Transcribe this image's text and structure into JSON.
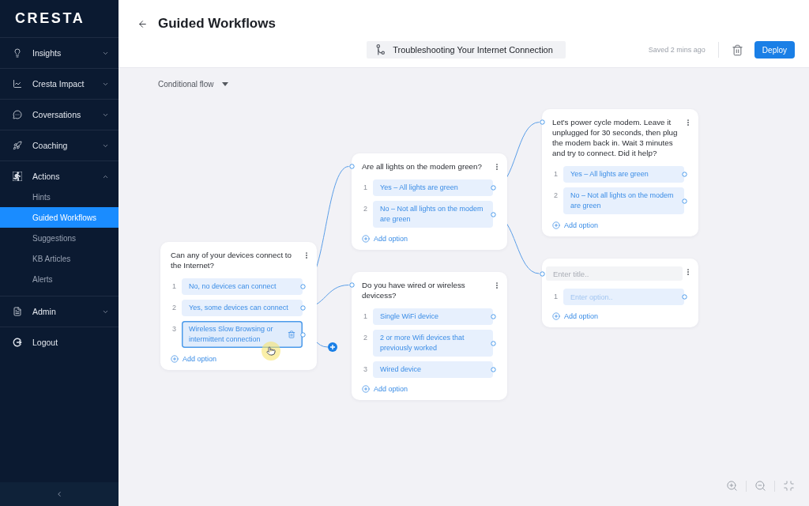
{
  "sidebar": {
    "logo": "CRESTA",
    "menus": [
      {
        "label": "Insights",
        "expanded": false
      },
      {
        "label": "Cresta Impact",
        "expanded": false
      },
      {
        "label": "Coversations",
        "expanded": false
      },
      {
        "label": "Coaching",
        "expanded": false
      },
      {
        "label": "Actions",
        "expanded": true,
        "children": [
          {
            "label": "Hints",
            "selected": false
          },
          {
            "label": "Guided Workflows",
            "selected": true
          },
          {
            "label": "Suggestions",
            "selected": false
          },
          {
            "label": "KB Articles",
            "selected": false
          },
          {
            "label": "Alerts",
            "selected": false
          }
        ]
      },
      {
        "label": "Admin",
        "expanded": false
      }
    ],
    "logout": "Logout"
  },
  "header": {
    "title": "Guided Workflows",
    "workflow_name": "Troubleshooting Your Internet Connection",
    "save_status": "Saved 2 mins ago",
    "deploy_button": "Deploy"
  },
  "canvas": {
    "view_selector": "Conditional flow",
    "nodes": [
      {
        "kind": "start",
        "title": "Can any of your devices connect to the Internet?",
        "options": [
          {
            "number": "1",
            "label": "No, no devices can connect",
            "selected": false
          },
          {
            "number": "2",
            "label": "Yes, some devices can connect",
            "selected": false
          },
          {
            "number": "3",
            "label": "Wireless Slow Browsing or intermittent connection",
            "selected": true
          }
        ],
        "add_option": "Add option"
      },
      {
        "kind": "question",
        "title": "Are all lights on the modem green?",
        "options": [
          {
            "number": "1",
            "label": "Yes – All lights are green",
            "selected": false
          },
          {
            "number": "2",
            "label": "No – Not all lights on the modem are green",
            "selected": false
          }
        ],
        "add_option": "Add option"
      },
      {
        "kind": "question",
        "title": "Do you have wired or wireless devicess?",
        "options": [
          {
            "number": "1",
            "label": "Single WiFi device",
            "selected": false
          },
          {
            "number": "2",
            "label": "2 or more Wifi devices that previously worked",
            "selected": false
          },
          {
            "number": "3",
            "label": "Wired device",
            "selected": false
          }
        ],
        "add_option": "Add option"
      },
      {
        "kind": "question",
        "title": "Let’s power cycle modem. Leave it unplugged for 30 seconds, then plug the modem back in. Wait 3 minutes and try to connect. Did it help?",
        "options": [
          {
            "number": "1",
            "label": "Yes – All lights are green",
            "selected": false
          },
          {
            "number": "2",
            "label": "No – Not all lights on the modem are green",
            "selected": false
          }
        ],
        "add_option": "Add option"
      },
      {
        "kind": "draft",
        "title_placeholder": "Enter title..",
        "options": [
          {
            "number": "1",
            "placeholder": "Enter option..",
            "selected": false
          }
        ],
        "add_option": "Add option"
      }
    ]
  }
}
